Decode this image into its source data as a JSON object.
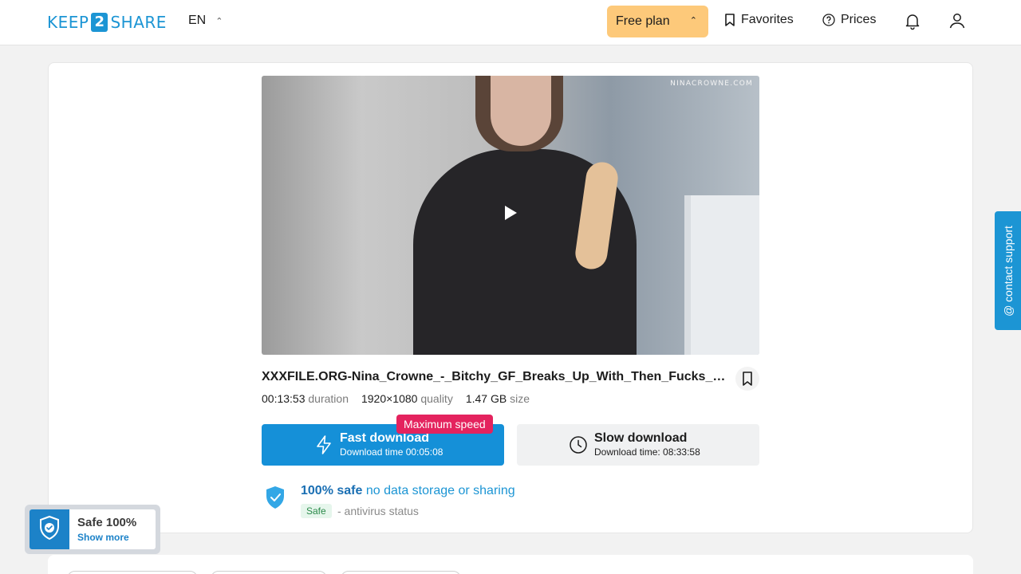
{
  "header": {
    "logo_left": "KEEP",
    "logo_mid": "2",
    "logo_right": "SHARE",
    "language": "EN",
    "plan_label": "Free plan",
    "favorites_label": "Favorites",
    "prices_label": "Prices"
  },
  "video": {
    "watermark": "NINACROWNE.COM"
  },
  "file": {
    "name": "XXXFILE.ORG-Nina_Crowne_-_Bitchy_GF_Breaks_Up_With_Then_Fucks_You_...",
    "duration_value": "00:13:53",
    "duration_label": "duration",
    "quality_value": "1920×1080",
    "quality_label": "quality",
    "size_value": "1.47 GB",
    "size_label": "size"
  },
  "download": {
    "fast_title": "Fast download",
    "fast_sub": "Download time 00:05:08",
    "max_speed": "Maximum speed",
    "slow_title": "Slow download",
    "slow_sub": "Download time: 08:33:58"
  },
  "safety": {
    "strong": "100% safe",
    "rest": " no data storage or sharing",
    "badge": "Safe",
    "antivirus": "- antivirus status"
  },
  "widget": {
    "title": "Safe 100%",
    "link": "Show more"
  },
  "support": {
    "label": "@ contact support"
  },
  "colors": {
    "accent": "#1590d8",
    "plan": "#fdc97a",
    "max_speed": "#e4235e"
  }
}
